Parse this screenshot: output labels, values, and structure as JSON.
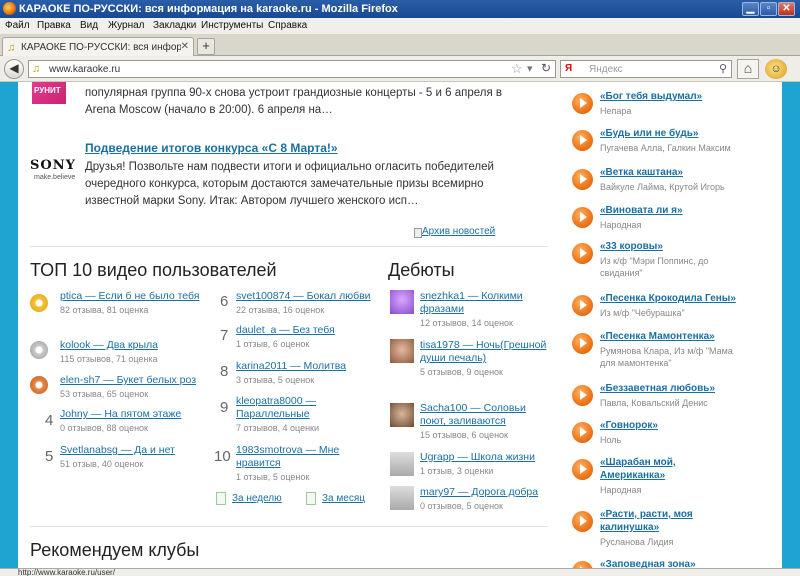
{
  "window": {
    "title": "КАРАОКЕ ПО-РУССКИ: вся информация на karaoke.ru - Mozilla Firefox"
  },
  "menu": [
    "Файл",
    "Правка",
    "Вид",
    "Журнал",
    "Закладки",
    "Инструменты",
    "Справка"
  ],
  "tab": {
    "label": "КАРАОКЕ ПО-РУССКИ: вся информация на..."
  },
  "nav": {
    "url": "www.karaoke.ru",
    "search_placeholder": "Яндекс",
    "search_engine": "Я"
  },
  "news": {
    "item1_text": "популярная группа 90-х снова устроит грандиозные концерты - 5 и 6 апреля в Arena Moscow (начало в 20:00). 6 апреля на…",
    "item1_logo": "РУНИТ",
    "item2_title": "Подведение итогов конкурса «С 8 Марта!»",
    "item2_text": "Друзья! Позвольте нам подвести итоги и официально огласить победителей очередного конкурса, которым достаются замечательные призы всемирно известной марки Sony. Итак: Автором лучшего женского исп…",
    "sony": "SONY",
    "sony_tag": "make.believe",
    "archive": "Архив новостей"
  },
  "top10": {
    "title": "ТОП 10 видео пользователей",
    "items": [
      {
        "n": "1",
        "link": "ptica — Если б не было тебя",
        "stats": "82 отзыва, 81 оценка"
      },
      {
        "n": "2",
        "link": "kolook — Два крыла",
        "stats": "115 отзывов, 71 оценка"
      },
      {
        "n": "3",
        "link": "elen-sh7 — Букет белых роз",
        "stats": "53 отзыва, 65 оценок"
      },
      {
        "n": "4",
        "link": "Johny — На пятом этаже",
        "stats": "0 отзывов, 88 оценок"
      },
      {
        "n": "5",
        "link": "Svetlanabsg — Да и нет",
        "stats": "51 отзыв, 40 оценок"
      },
      {
        "n": "6",
        "link": "svet100874 — Бокал любви",
        "stats": "22 отзыва, 16 оценок"
      },
      {
        "n": "7",
        "link": "daulet_a — Без тебя",
        "stats": "1 отзыв, 6 оценок"
      },
      {
        "n": "8",
        "link": "karina2011 — Молитва",
        "stats": "3 отзыва, 5 оценок"
      },
      {
        "n": "9",
        "link": "kleopatra8000 — Параллельные",
        "stats": "7 отзывов, 4 оценки"
      },
      {
        "n": "10",
        "link": "1983smotrova — Мне нравится",
        "stats": "1 отзыв, 5 оценок"
      }
    ],
    "week": "За неделю",
    "month": "За месяц"
  },
  "debuts": {
    "title": "Дебюты",
    "items": [
      {
        "link": "snezhka1 — Колкими фразами",
        "stats": "12 отзывов, 14 оценок"
      },
      {
        "link": "tisa1978 — Ночь(Грешной души печаль)",
        "stats": "5 отзывов, 9 оценок"
      },
      {
        "link": "Sacha100 — Соловьи поют, заливаются",
        "stats": "15 отзывов, 6 оценок"
      },
      {
        "link": "Ugrapp — Школа жизни",
        "stats": "1 отзыв, 3 оценки"
      },
      {
        "link": "mary97 — Дорога добра",
        "stats": "0 отзывов, 5 оценок"
      }
    ]
  },
  "clubs": {
    "title": "Рекомендуем клубы"
  },
  "sidebar": [
    {
      "title": "«Бог тебя выдумал»",
      "artist": "Непара"
    },
    {
      "title": "«Будь или не будь»",
      "artist": "Пугачева Алла, Галкин Максим"
    },
    {
      "title": "«Ветка каштана»",
      "artist": "Вайкуле Лайма, Крутой Игорь"
    },
    {
      "title": "«Виновата ли я»",
      "artist": "Народная"
    },
    {
      "title": "«33 коровы»",
      "artist": "Из к/ф \"Мэри Поппинс, до свидания\""
    },
    {
      "title": "«Песенка Крокодила Гены»",
      "artist": "Из м/ф \"Чебурашка\""
    },
    {
      "title": "«Песенка Мамонтенка»",
      "artist": "Румянова Клара, Из м/ф \"Мама для мамонтенка\""
    },
    {
      "title": "«Беззаветная любовь»",
      "artist": "Павла, Ковальский Денис"
    },
    {
      "title": "«Говнорок»",
      "artist": "Ноль"
    },
    {
      "title": "«Шарабан мой, Американка»",
      "artist": "Народная"
    },
    {
      "title": "«Расти, расти, моя калинушка»",
      "artist": "Русланова Лидия"
    },
    {
      "title": "«Заповедная зона»",
      "artist": ""
    }
  ],
  "status": {
    "text": "http://www.karaoke.ru/user/"
  }
}
